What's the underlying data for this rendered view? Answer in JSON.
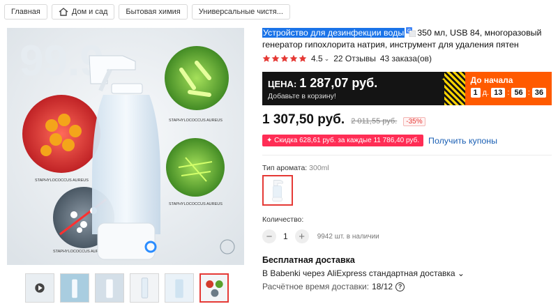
{
  "breadcrumb": [
    "Главная",
    "Дом и сад",
    "Бытовая химия",
    "Универсальные чистя..."
  ],
  "product": {
    "title_highlight": "Устройство для дезинфекции воды",
    "title_rest": "350 мл, USB 84, многоразовый генератор гипохлорита натрия, инструмент для удаления пятен",
    "rating": "4.5",
    "stars": 5,
    "reviews": "22 Отзывы",
    "orders": "43 заказа(ов)"
  },
  "promo": {
    "label": "ЦЕНА:",
    "price": "1 287,07 руб.",
    "sub": "Добавьте в корзину!",
    "countdown_label": "До начала",
    "days": "1",
    "days_unit": "д.",
    "hours": "13",
    "minutes": "56",
    "seconds": "36"
  },
  "pricing": {
    "current": "1 307,50 руб.",
    "old": "2 011,55 руб.",
    "discount": "-35%",
    "coupon": "✦ Скидка 628,61 руб. за каждые 11 786,40 руб.",
    "coupon_link": "Получить купоны"
  },
  "options": {
    "aroma_label": "Тип аромата:",
    "aroma_value": "300ml"
  },
  "quantity": {
    "label": "Количество:",
    "value": "1",
    "stock": "9942 шт. в наличии"
  },
  "shipping": {
    "title": "Бесплатная доставка",
    "line": "В Babenki через AliExpress стандартная доставка ⌄",
    "eta_label": "Расчётное время доставки:",
    "eta_value": "18/12"
  },
  "image_labels": {
    "top_number": "99.9",
    "staph1": "STAPHYLOCOCCUS AUREUS",
    "staph2": "STAPHYLOCOCCUS AUREUS",
    "staph3": "STAPHYLOCOCCUS AUREUS",
    "staph4": "STAPHYLOCOCCUS AUREUS",
    "staph5": "STAPHYLOCOCCUS AUREUS"
  },
  "colors": {
    "accent": "#e53935",
    "promo_dark": "#141414",
    "promo_orange": "#ff5a00",
    "link": "#1a5fb4"
  }
}
